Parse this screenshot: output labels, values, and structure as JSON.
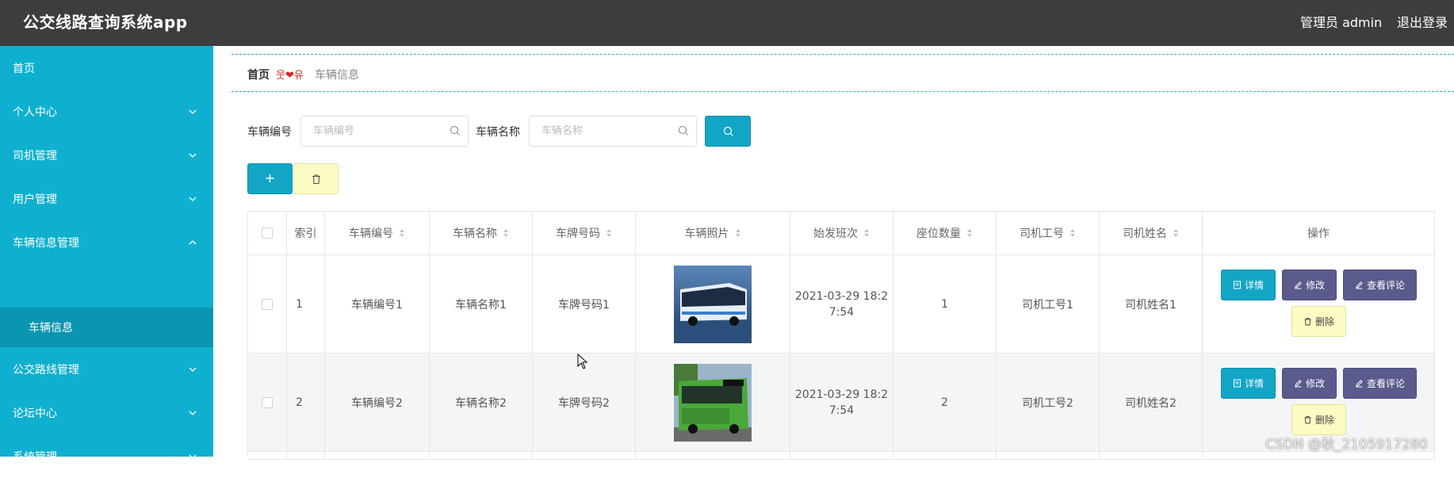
{
  "app": {
    "title": "公交线路查询系统app",
    "user": "管理员 admin",
    "logout": "退出登录"
  },
  "sidebar": {
    "items": [
      {
        "label": "首页"
      },
      {
        "label": "个人中心"
      },
      {
        "label": "司机管理"
      },
      {
        "label": "用户管理"
      },
      {
        "label": "车辆信息管理"
      },
      {
        "label": "公交路线管理"
      },
      {
        "label": "论坛中心"
      },
      {
        "label": "系统管理"
      }
    ],
    "sub_item": "车辆信息"
  },
  "breadcrumb": {
    "home": "首页",
    "separator": "웃❤유",
    "current": "车辆信息"
  },
  "search": {
    "field1_label": "车辆编号",
    "field1_placeholder": "车辆编号",
    "field2_label": "车辆名称",
    "field2_placeholder": "车辆名称"
  },
  "toolbar": {
    "add": "+"
  },
  "table": {
    "headers": [
      "索引",
      "车辆编号",
      "车辆名称",
      "车牌号码",
      "车辆照片",
      "始发班次",
      "座位数量",
      "司机工号",
      "司机姓名",
      "操作"
    ],
    "rows": [
      {
        "index": "1",
        "code": "车辆编号1",
        "name": "车辆名称1",
        "plate": "车牌号码1",
        "time_line1": "2021-03-29 18:2",
        "time_line2": "7:54",
        "seats": "1",
        "driver_id": "司机工号1",
        "driver_name": "司机姓名1"
      },
      {
        "index": "2",
        "code": "车辆编号2",
        "name": "车辆名称2",
        "plate": "车牌号码2",
        "time_line1": "2021-03-29 18:2",
        "time_line2": "7:54",
        "seats": "2",
        "driver_id": "司机工号2",
        "driver_name": "司机姓名2"
      }
    ],
    "actions": {
      "detail": "详情",
      "edit": "修改",
      "review": "查看评论",
      "delete": "删除"
    }
  },
  "watermark": "CSDN @秋_2105917280",
  "colors": {
    "topbar": "#3d3d3d",
    "sidebar": "#0fb0cf",
    "primary": "#13a5c6",
    "secondary": "#5a5a8c",
    "warning_bg": "#fdfbc4"
  }
}
